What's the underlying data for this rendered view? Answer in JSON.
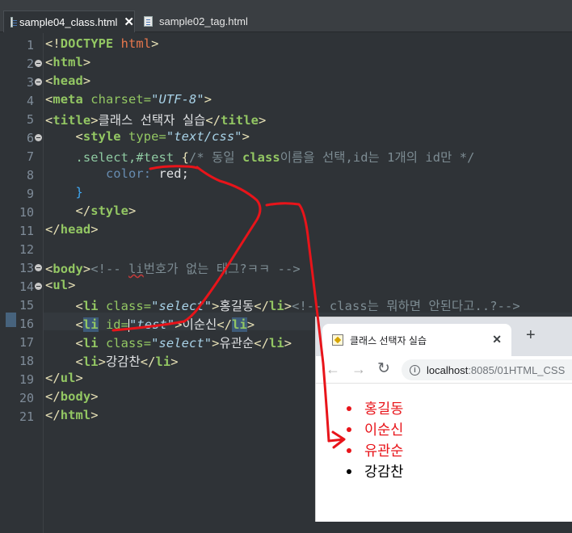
{
  "tabs": [
    {
      "label": "sample04_class.html",
      "active": true,
      "close": "✕"
    },
    {
      "label": "sample02_tag.html",
      "active": false
    }
  ],
  "editor": {
    "lines": [
      {
        "n": "1",
        "fold": false
      },
      {
        "n": "2",
        "fold": true
      },
      {
        "n": "3",
        "fold": true
      },
      {
        "n": "4",
        "fold": false
      },
      {
        "n": "5",
        "fold": false
      },
      {
        "n": "6",
        "fold": true
      },
      {
        "n": "7",
        "fold": false
      },
      {
        "n": "8",
        "fold": false
      },
      {
        "n": "9",
        "fold": false
      },
      {
        "n": "10",
        "fold": false
      },
      {
        "n": "11",
        "fold": false
      },
      {
        "n": "12",
        "fold": false
      },
      {
        "n": "13",
        "fold": true
      },
      {
        "n": "14",
        "fold": true
      },
      {
        "n": "15",
        "fold": false
      },
      {
        "n": "16",
        "fold": false
      },
      {
        "n": "17",
        "fold": false
      },
      {
        "n": "18",
        "fold": false
      },
      {
        "n": "19",
        "fold": false
      },
      {
        "n": "20",
        "fold": false
      },
      {
        "n": "21",
        "fold": false
      }
    ],
    "code": {
      "l1_a": "<!",
      "l1_b": "DOCTYPE",
      "l1_c": " html",
      "l1_d": ">",
      "l2_a": "<",
      "l2_b": "html",
      "l2_c": ">",
      "l3_a": "<",
      "l3_b": "head",
      "l3_c": ">",
      "l4_a": "<",
      "l4_b": "meta",
      "l4_c": " charset=",
      "l4_d": "\"UTF-8\"",
      "l4_e": ">",
      "l5_a": "<",
      "l5_b": "title",
      "l5_c": ">",
      "l5_d": "클래스 선택자 실습",
      "l5_e": "</",
      "l5_f": "title",
      "l5_g": ">",
      "l6_indent": "    ",
      "l6_a": "<",
      "l6_b": "style",
      "l6_c": " type=",
      "l6_d": "\"text/css\"",
      "l6_e": ">",
      "l7_indent": "    ",
      "l7_a": ".select,#test ",
      "l7_b": "{",
      "l7_c": "/* 동일 ",
      "l7_d": "class",
      "l7_e": "이름을 선택,id는 1개의 id만 */",
      "l8_indent": "        ",
      "l8_a": "color: ",
      "l8_b": "red",
      "l8_c": ";",
      "l9_indent": "    ",
      "l9_a": "}",
      "l10_indent": "    ",
      "l10_a": "</",
      "l10_b": "style",
      "l10_c": ">",
      "l11_a": "</",
      "l11_b": "head",
      "l11_c": ">",
      "l13_a": "<",
      "l13_b": "body",
      "l13_c": ">",
      "l13_d": "<!-- ",
      "l13_e": "li",
      "l13_f": "번호가 없는 태그?ㅋㅋ -->",
      "l14_a": "<",
      "l14_b": "ul",
      "l14_c": ">",
      "l15_indent": "    ",
      "l15_a": "<",
      "l15_b": "li",
      "l15_c": " class=",
      "l15_d": "\"select\"",
      "l15_e": ">",
      "l15_f": "홍길동",
      "l15_g": "</",
      "l15_h": "li",
      "l15_i": ">",
      "l15_j": "<!-- class는 뭐하면 안된다고..?-->",
      "l16_indent": "    ",
      "l16_a": "<",
      "l16_b": "li",
      "l16_c": " id=",
      "l16_d": "\"test\"",
      "l16_e": ">",
      "l16_f": "이순신",
      "l16_g": "</",
      "l16_h": "li",
      "l16_i": ">",
      "l17_indent": "    ",
      "l17_a": "<",
      "l17_b": "li",
      "l17_c": " class=",
      "l17_d": "\"select\"",
      "l17_e": ">",
      "l17_f": "유관순",
      "l17_g": "</",
      "l17_h": "li",
      "l17_i": ">",
      "l18_indent": "    ",
      "l18_a": "<",
      "l18_b": "li",
      "l18_c": ">",
      "l18_d": "강감찬",
      "l18_e": "</",
      "l18_f": "li",
      "l18_g": ">",
      "l19_a": "</",
      "l19_b": "ul",
      "l19_c": ">",
      "l20_a": "</",
      "l20_b": "body",
      "l20_c": ">",
      "l21_a": "</",
      "l21_b": "html",
      "l21_c": ">"
    }
  },
  "browser": {
    "tab_title": "클래스 선택자 실습",
    "tab_close": "✕",
    "new_tab": "+",
    "back": "←",
    "forward": "→",
    "reload": "↻",
    "url_host": "localhost",
    "url_path": ":8085/01HTML_CSS",
    "list": [
      {
        "text": "홍길동",
        "color": "#e8141a"
      },
      {
        "text": "이순신",
        "color": "#e8141a"
      },
      {
        "text": "유관순",
        "color": "#e8141a"
      },
      {
        "text": "강감찬",
        "color": "#000000"
      }
    ]
  },
  "colors": {
    "editor_bg": "#2f3337",
    "tag": "#93c763",
    "string": "#a9d3e8",
    "comment": "#7d8c93",
    "annotation": "#e8141a"
  }
}
